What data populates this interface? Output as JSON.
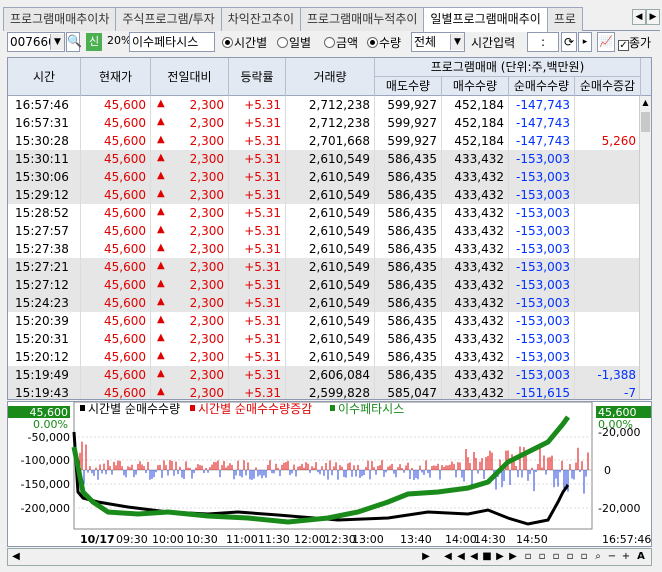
{
  "tabs": [
    "프로그램매매추이차",
    "주식프로그램/투자",
    "차익잔고추이",
    "프로그램매매누적추이",
    "일별프로그램매매추이",
    "프로"
  ],
  "toolbar": {
    "code": "007660",
    "market_badge": "신",
    "margin": "20%",
    "name": "이수페타시스",
    "opt_time": "시간별",
    "opt_day": "일별",
    "opt_amount": "금액",
    "opt_qty": "수량",
    "filter": "전체",
    "time_input_label": "시간입력",
    "time_value": ":",
    "close_check": "종가"
  },
  "table": {
    "group_header": "프로그램매매  (단위:주,백만원)",
    "columns": [
      "시간",
      "현재가",
      "전일대비",
      "등락률",
      "거래량",
      "매도수량",
      "매수수량",
      "순매수수량",
      "순매수증감"
    ],
    "rows": [
      [
        "16:57:46",
        "45,600",
        "2,300",
        "+5.31",
        "2,712,238",
        "599,927",
        "452,184",
        "-147,743",
        ""
      ],
      [
        "16:57:31",
        "45,600",
        "2,300",
        "+5.31",
        "2,712,238",
        "599,927",
        "452,184",
        "-147,743",
        ""
      ],
      [
        "15:30:28",
        "45,600",
        "2,300",
        "+5.31",
        "2,701,668",
        "599,927",
        "452,184",
        "-147,743",
        "5,260"
      ],
      [
        "15:30:11",
        "45,600",
        "2,300",
        "+5.31",
        "2,610,549",
        "586,435",
        "433,432",
        "-153,003",
        ""
      ],
      [
        "15:30:06",
        "45,600",
        "2,300",
        "+5.31",
        "2,610,549",
        "586,435",
        "433,432",
        "-153,003",
        ""
      ],
      [
        "15:29:12",
        "45,600",
        "2,300",
        "+5.31",
        "2,610,549",
        "586,435",
        "433,432",
        "-153,003",
        ""
      ],
      [
        "15:28:52",
        "45,600",
        "2,300",
        "+5.31",
        "2,610,549",
        "586,435",
        "433,432",
        "-153,003",
        ""
      ],
      [
        "15:27:57",
        "45,600",
        "2,300",
        "+5.31",
        "2,610,549",
        "586,435",
        "433,432",
        "-153,003",
        ""
      ],
      [
        "15:27:38",
        "45,600",
        "2,300",
        "+5.31",
        "2,610,549",
        "586,435",
        "433,432",
        "-153,003",
        ""
      ],
      [
        "15:27:21",
        "45,600",
        "2,300",
        "+5.31",
        "2,610,549",
        "586,435",
        "433,432",
        "-153,003",
        ""
      ],
      [
        "15:27:12",
        "45,600",
        "2,300",
        "+5.31",
        "2,610,549",
        "586,435",
        "433,432",
        "-153,003",
        ""
      ],
      [
        "15:24:23",
        "45,600",
        "2,300",
        "+5.31",
        "2,610,549",
        "586,435",
        "433,432",
        "-153,003",
        ""
      ],
      [
        "15:20:39",
        "45,600",
        "2,300",
        "+5.31",
        "2,610,549",
        "586,435",
        "433,432",
        "-153,003",
        ""
      ],
      [
        "15:20:31",
        "45,600",
        "2,300",
        "+5.31",
        "2,610,549",
        "586,435",
        "433,432",
        "-153,003",
        ""
      ],
      [
        "15:20:12",
        "45,600",
        "2,300",
        "+5.31",
        "2,610,549",
        "586,435",
        "433,432",
        "-153,003",
        ""
      ],
      [
        "15:19:49",
        "45,600",
        "2,300",
        "+5.31",
        "2,606,084",
        "586,435",
        "433,432",
        "-153,003",
        "-1,388"
      ],
      [
        "15:19:43",
        "45,600",
        "2,300",
        "+5.31",
        "2,599,828",
        "585,047",
        "433,432",
        "-151,615",
        "-7"
      ]
    ]
  },
  "chart": {
    "legend": [
      "시간별 순매수수량",
      "시간별 순매수수량증감",
      "이수페타시스"
    ],
    "left_ticks": [
      "-50,000",
      "-100,000",
      "-150,000",
      "-200,000"
    ],
    "left_price": "45,600",
    "left_pct": "0.00%",
    "right_price": "45,600",
    "right_pct": "0.00%",
    "right_ticks": [
      "-20,000",
      "0",
      "-20,000"
    ],
    "x_labels": [
      "10/17",
      "09:30",
      "10:00",
      "10:30",
      "11:00",
      "11:30",
      "12:00",
      "12:30",
      "13:00",
      "13:40",
      "14:00",
      "14:30",
      "14:50"
    ],
    "last_time": "16:57:46",
    "colors": {
      "net": "#000000",
      "delta": "#e00000",
      "price": "#1a8a1a"
    }
  },
  "chart_data": {
    "type": "line",
    "title": "",
    "series": [
      {
        "name": "시간별 순매수수량",
        "x": [
          "09:00",
          "09:30",
          "10:00",
          "10:30",
          "11:00",
          "11:30",
          "12:00",
          "12:30",
          "13:00",
          "13:40",
          "14:00",
          "14:30",
          "14:50",
          "15:30"
        ],
        "values": [
          -20000,
          -150000,
          -200000,
          -210000,
          -205000,
          -200000,
          -210000,
          -210000,
          -205000,
          -205000,
          -205000,
          -190000,
          -210000,
          -147743
        ]
      }
    ],
    "ylim": [
      -230000,
      -20000
    ]
  }
}
